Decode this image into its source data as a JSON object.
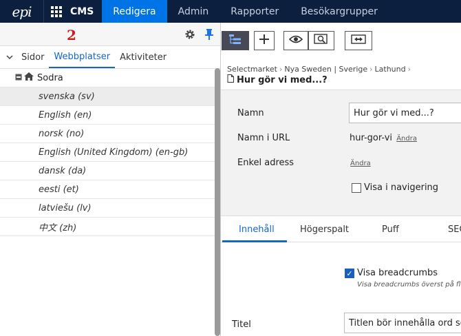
{
  "topbar": {
    "logo_text": "epi",
    "app_name": "CMS",
    "nav": [
      "Redigera",
      "Admin",
      "Rapporter",
      "Besökargrupper"
    ],
    "active_nav": "Redigera",
    "bg_color": "#0c1f3f",
    "active_color": "#0073e6"
  },
  "left_pane": {
    "annotation_number": "2",
    "tabs": [
      "Sidor",
      "Webbplatser",
      "Aktiviteter"
    ],
    "active_tab": "Webbplatser",
    "tree_root": "Sodra",
    "rows": [
      "svenska (sv)",
      "English (en)",
      "norsk (no)",
      "English (United Kingdom) (en-gb)",
      "dansk (da)",
      "eesti (et)",
      "latviešu (lv)",
      "中文 (zh)"
    ],
    "selected_row": "svenska (sv)"
  },
  "breadcrumb": [
    "Selectmarket",
    "Nya Sweden | Sverige",
    "Lathund"
  ],
  "page_title": "Hur gör vi med...?",
  "properties": {
    "name_label": "Namn",
    "name_value": "Hur gör vi med...?",
    "url_label": "Namn i URL",
    "url_value": "hur-gor-vi",
    "change_link": "Ändra",
    "simple_address_label": "Enkel adress",
    "simple_address_link": "Ändra",
    "show_in_nav_label": "Visa i navigering"
  },
  "content_tabs": [
    "Innehåll",
    "Högerspalt",
    "Puff",
    "SEO"
  ],
  "content": {
    "breadcrumbs_label": "Visa breadcrumbs",
    "breadcrumbs_note": "Visa breadcrumbs överst på flera",
    "title_label": "Titel",
    "title_value": "Titlen bör innehålla ord som"
  }
}
